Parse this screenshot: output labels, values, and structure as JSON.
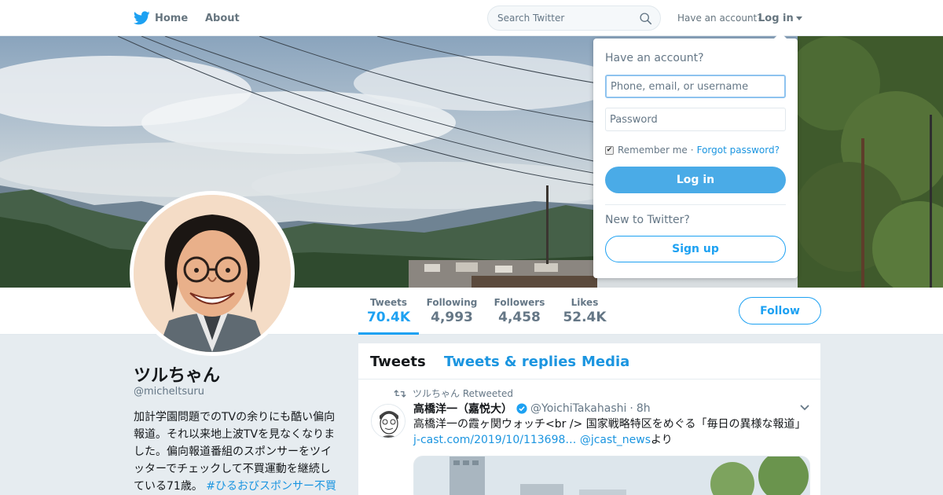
{
  "nav": {
    "home_label": "Home",
    "about_label": "About",
    "search_placeholder": "Search Twitter",
    "have_account": "Have an account?",
    "login_label": "Log in"
  },
  "profile": {
    "name": "ツルちゃん",
    "handle": "@micheltsuru",
    "bio_text": "加計学園問題でのTVの余りにも酷い偏向報道。それ以来地上波TVを見なくなりました。偏向報道番組のスポンサーをツイッターでチェックして不買運動を継続している71歳。 ",
    "bio_hashtag": "#ひるおびスポンサー不買運動"
  },
  "stats": [
    {
      "label": "Tweets",
      "value": "70.4K"
    },
    {
      "label": "Following",
      "value": "4,993"
    },
    {
      "label": "Followers",
      "value": "4,458"
    },
    {
      "label": "Likes",
      "value": "52.4K"
    }
  ],
  "follow_label": "Follow",
  "timeline": {
    "tabs": [
      "Tweets",
      "Tweets & replies",
      "Media"
    ],
    "retweet_line": "ツルちゃん Retweeted",
    "tweet": {
      "fullname": "高橋洋一（嘉悦大）",
      "username": "@YoichiTakahashi",
      "separator": "·",
      "time": "8h",
      "text": "高橋洋一の霞ヶ関ウォッチ<br /> 国家戦略特区をめぐる「毎日の異様な報道」 ",
      "link1": "j-cast.com/2019/10/113698…",
      "link2": "@jcast_news",
      "suffix": "より"
    }
  },
  "login_dropdown": {
    "title": "Have an account?",
    "username_placeholder": "Phone, email, or username",
    "password_placeholder": "Password",
    "remember_label": "Remember me",
    "separator": "·",
    "forgot_label": "Forgot password?",
    "login_button": "Log in",
    "new_to_twitter": "New to Twitter?",
    "signup_button": "Sign up"
  },
  "colors": {
    "accent": "#1da1f2",
    "link": "#1b95e0",
    "background": "#e6ecf0"
  },
  "icons": [
    "twitter-bird-icon",
    "search-icon",
    "caret-down-icon",
    "retweet-icon",
    "verified-badge-icon",
    "chevron-down-icon"
  ]
}
